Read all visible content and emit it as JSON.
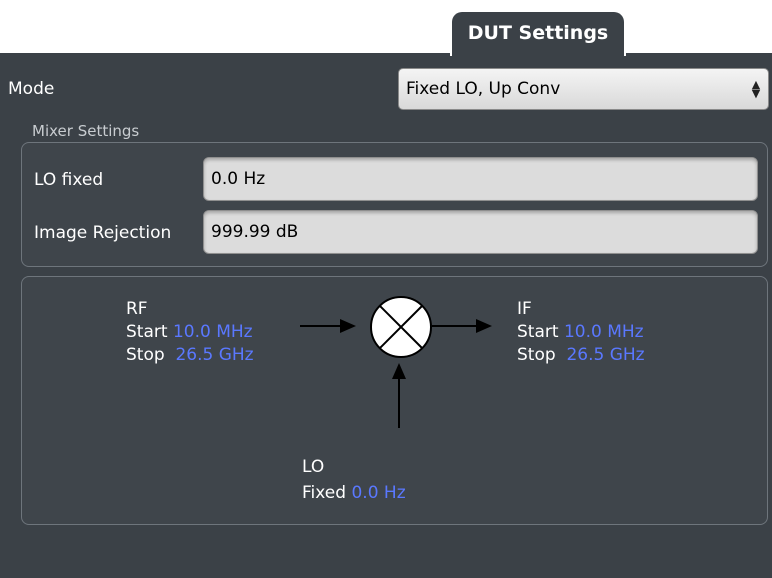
{
  "tab": {
    "label": "DUT Settings"
  },
  "mode": {
    "label": "Mode",
    "value": "Fixed LO, Up Conv"
  },
  "mixer_settings": {
    "title": "Mixer Settings",
    "lo_fixed": {
      "label": "LO fixed",
      "value": "0.0 Hz"
    },
    "image_rejection": {
      "label": "Image Rejection",
      "value": "999.99 dB"
    }
  },
  "diagram": {
    "rf": {
      "title": "RF",
      "start_label": "Start",
      "start_value": "10.0 MHz",
      "stop_label": "Stop",
      "stop_value": "26.5 GHz"
    },
    "if": {
      "title": "IF",
      "start_label": "Start",
      "start_value": "10.0 MHz",
      "stop_label": "Stop",
      "stop_value": "26.5 GHz"
    },
    "lo": {
      "title": "LO",
      "fixed_label": "Fixed",
      "fixed_value": "0.0 Hz"
    },
    "mixer_symbol": "mixer-icon"
  },
  "colors": {
    "panel_bg": "#3b4147",
    "value_blue": "#5a78ff",
    "field_bg": "#dcdcdc"
  }
}
